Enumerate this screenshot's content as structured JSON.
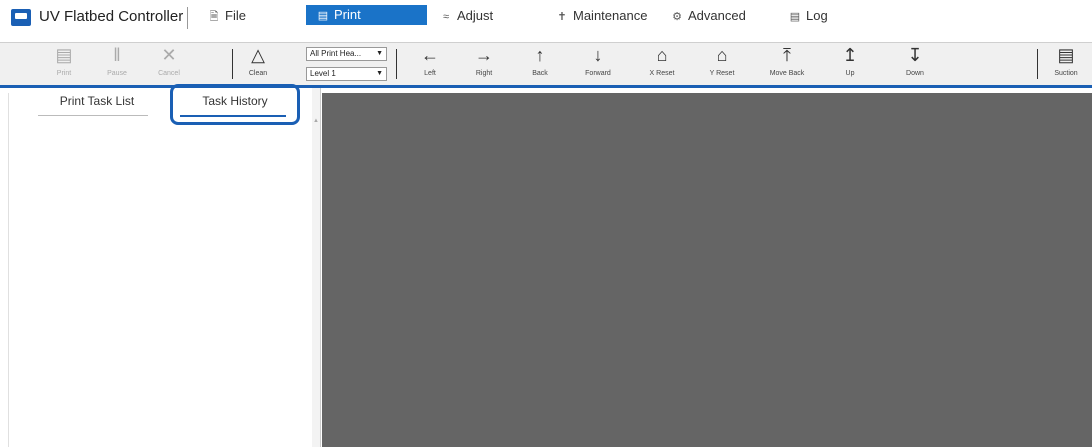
{
  "app": {
    "title": "UV Flatbed Controller"
  },
  "menu": [
    {
      "label": "File",
      "icon": "file-icon"
    },
    {
      "label": "Print",
      "icon": "printer-icon",
      "active": true
    },
    {
      "label": "Adjust",
      "icon": "adjust-icon"
    },
    {
      "label": "Maintenance",
      "icon": "maintenance-icon"
    },
    {
      "label": "Advanced",
      "icon": "advanced-icon"
    },
    {
      "label": "Log",
      "icon": "log-icon"
    }
  ],
  "toolbar": {
    "print": "Print",
    "pause": "Pause",
    "cancel": "Cancel",
    "clean": "Clean",
    "head_select": "All Print Hea...",
    "level_select": "Level 1",
    "left": "Left",
    "right": "Right",
    "back": "Back",
    "forward": "Forward",
    "x_reset": "X Reset",
    "y_reset": "Y Reset",
    "move_back": "Move Back",
    "up": "Up",
    "down": "Down",
    "suction": "Suction"
  },
  "tabs": {
    "print_task_list": "Print Task List",
    "task_history": "Task History"
  },
  "colors": {
    "accent": "#1a5fb4",
    "active_menu": "#1a73c8",
    "preview_bg": "#656565"
  }
}
